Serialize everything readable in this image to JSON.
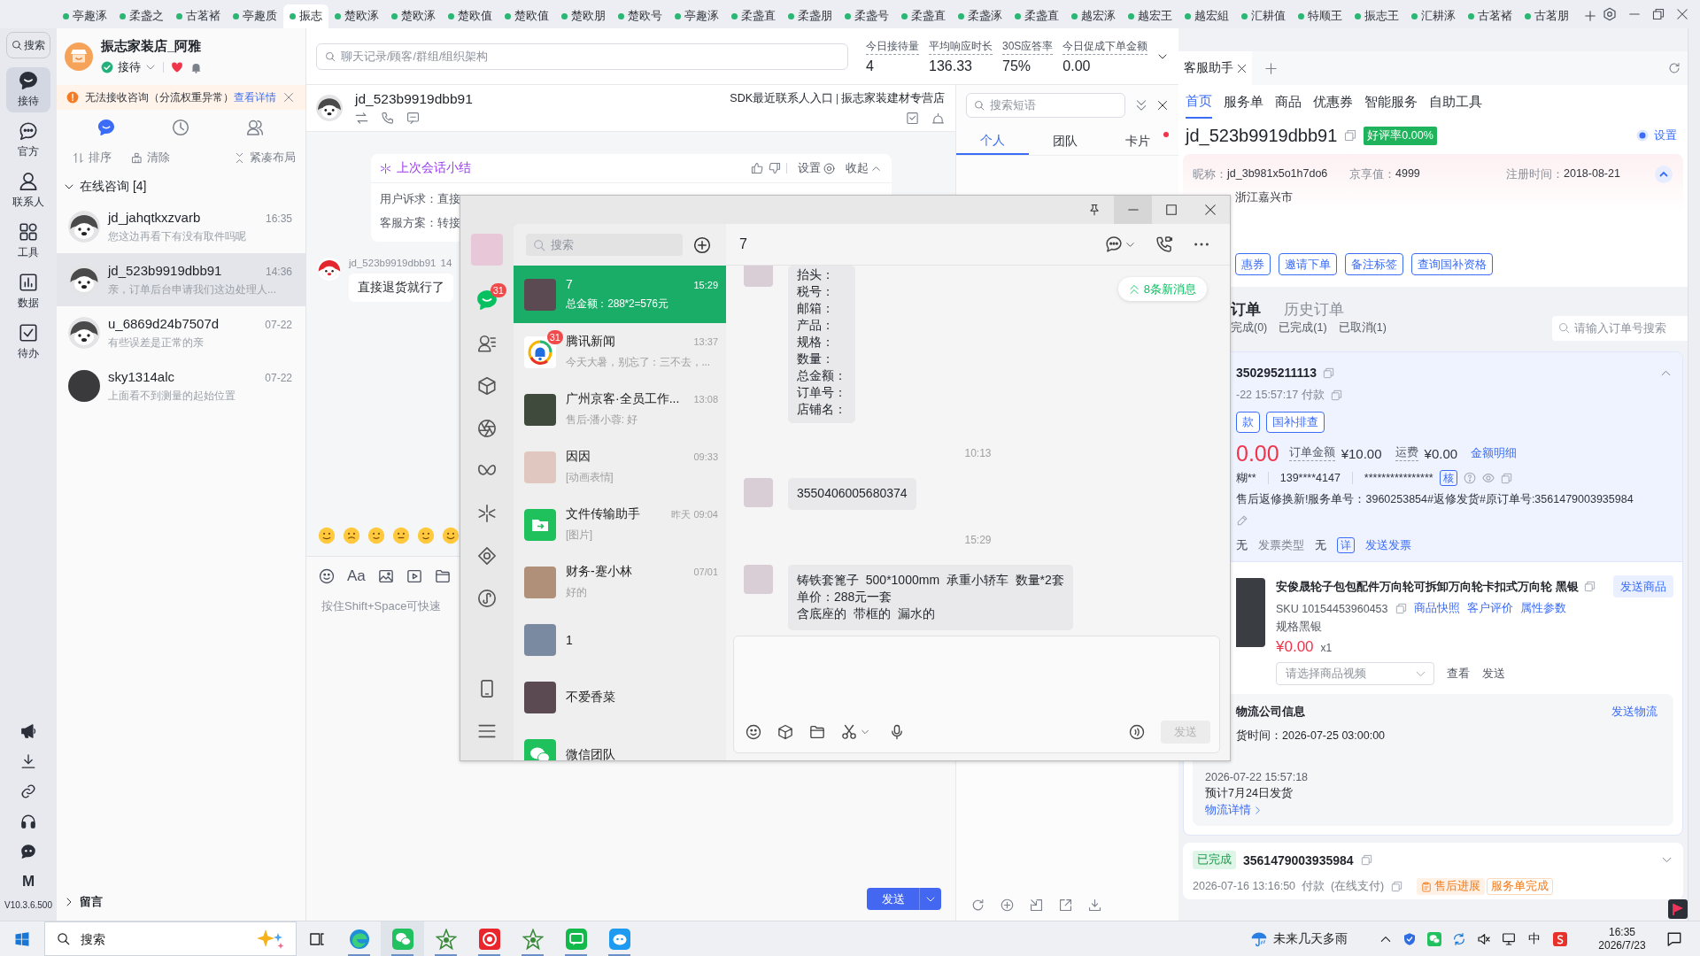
{
  "tab_bar": {
    "tabs": [
      {
        "label": "亭趣涿",
        "selected": false
      },
      {
        "label": "柔盏之",
        "selected": false
      },
      {
        "label": "古茗褚",
        "selected": false
      },
      {
        "label": "亭趣质",
        "selected": false
      },
      {
        "label": "振志",
        "selected": true
      },
      {
        "label": "楚欧涿",
        "selected": false
      },
      {
        "label": "楚欧涿",
        "selected": false
      },
      {
        "label": "楚欧值",
        "selected": false
      },
      {
        "label": "楚欧值",
        "selected": false
      },
      {
        "label": "楚欧朋",
        "selected": false
      },
      {
        "label": "楚欧号",
        "selected": false
      },
      {
        "label": "亭趣涿",
        "selected": false
      },
      {
        "label": "柔盏直",
        "selected": false
      },
      {
        "label": "柔盏朋",
        "selected": false
      },
      {
        "label": "柔盏号",
        "selected": false
      },
      {
        "label": "柔盏直",
        "selected": false
      },
      {
        "label": "柔盏涿",
        "selected": false
      },
      {
        "label": "柔盏直",
        "selected": false
      },
      {
        "label": "越宏涿",
        "selected": false
      },
      {
        "label": "越宏王",
        "selected": false
      },
      {
        "label": "越宏組",
        "selected": false
      },
      {
        "label": "汇耕值",
        "selected": false
      },
      {
        "label": "特顺王",
        "selected": false
      },
      {
        "label": "振志王",
        "selected": false
      },
      {
        "label": "汇耕涿",
        "selected": false
      },
      {
        "label": "古茗褚",
        "selected": false
      },
      {
        "label": "古茗朋",
        "selected": false
      }
    ]
  },
  "nav": {
    "search": "搜索",
    "items": [
      {
        "label": "接待",
        "selected": true
      },
      {
        "label": "官方",
        "selected": false
      },
      {
        "label": "联系人",
        "selected": false
      },
      {
        "label": "工具",
        "selected": false
      },
      {
        "label": "数据",
        "selected": false
      },
      {
        "label": "待办",
        "selected": false
      }
    ],
    "logo": "M",
    "version": "V10.3.6.500"
  },
  "shop": {
    "name": "振志家装店_阿雅",
    "status": "接待",
    "online": true
  },
  "alert": {
    "text": "无法接收咨询（分流权重异常）",
    "link": "查看详情"
  },
  "list_tabs": [
    {
      "kind": "chat",
      "selected": true
    },
    {
      "kind": "history",
      "selected": false
    },
    {
      "kind": "contacts",
      "selected": false
    }
  ],
  "list_actions": [
    {
      "kind": "sort",
      "label": "排序"
    },
    {
      "kind": "clear",
      "label": "清除"
    },
    {
      "kind": "compact",
      "label": "紧凑布局"
    }
  ],
  "group": {
    "title": "在线咨询 [4]",
    "expanded": true
  },
  "conversations": [
    {
      "kind": "mascot",
      "name": "jd_jahqtkxzvarb",
      "time": "16:35",
      "preview": "您这边再看下有没有取件吗呢",
      "selected": false
    },
    {
      "kind": "mascot",
      "name": "jd_523b9919dbb91",
      "time": "14:36",
      "preview": "亲，订单后台申请我们这边处理人...",
      "selected": true
    },
    {
      "kind": "mascot",
      "name": "u_6869d24b7507d",
      "time": "07-22",
      "preview": "有些误差是正常的亲",
      "selected": false
    },
    {
      "kind": "photo",
      "name": "sky1314alc",
      "time": "07-22",
      "preview": "上面看不到测量的起始位置",
      "selected": false
    }
  ],
  "collapsed_group": {
    "title": "留言",
    "expanded": false
  },
  "workspace": {
    "search_placeholder": "聊天记录/顾客/群组/组织架构",
    "metrics": [
      {
        "label": "今日接待量",
        "value": "4"
      },
      {
        "label": "平均响应时长",
        "value": "136.33"
      },
      {
        "label": "30S应答率",
        "value": "75%"
      },
      {
        "label": "今日促成下单金额",
        "value": "0.00"
      }
    ]
  },
  "chat": {
    "name": "jd_523b9919dbb91",
    "header_links": [
      "SDK最近联系人入口",
      "振志家装建材专营店"
    ],
    "summary": {
      "title": "上次会话小结",
      "settings": "设置",
      "collapse": "收起",
      "rows": [
        "用户诉求：直接",
        "客服方案：转接"
      ]
    },
    "messages": [
      {
        "sender": "jd_523b9919dbb91",
        "time": "14",
        "text": "直接退货就行了"
      }
    ],
    "format_label": "Aa",
    "input_placeholder": "按住Shift+Space可快速",
    "send": "发送"
  },
  "quick_replies": {
    "search_placeholder": "搜索短语",
    "tabs": [
      {
        "label": "个人",
        "selected": true,
        "unread": false
      },
      {
        "label": "团队",
        "selected": false,
        "unread": false
      },
      {
        "label": "卡片",
        "selected": false,
        "unread": true
      }
    ]
  },
  "assistant": {
    "tab": "客服助手",
    "nav": [
      {
        "label": "首页",
        "selected": true
      },
      {
        "label": "服务单",
        "selected": false
      },
      {
        "label": "商品",
        "selected": false
      },
      {
        "label": "优惠券",
        "selected": false
      },
      {
        "label": "智能服务",
        "selected": false
      },
      {
        "label": "自助工具",
        "selected": false
      }
    ],
    "customer": {
      "name": "jd_523b9919dbb91",
      "rating": "好评率0.00%",
      "settings": "设置"
    },
    "profile": [
      {
        "label": "昵称：",
        "value": "jd_3b981x5o1h7do6"
      },
      {
        "label": "京享值：",
        "value": "4999"
      },
      {
        "label": "注册时间：",
        "value": "2018-08-21"
      }
    ],
    "region": "浙江嘉兴市",
    "actions": [
      "惠券",
      "邀请下单",
      "备注标签",
      "查询国补资格"
    ],
    "order_tabs": [
      {
        "label": "订单",
        "selected": true
      },
      {
        "label": "历史订单",
        "selected": false
      }
    ],
    "order_filters": [
      "完成(0)",
      "已完成(1)",
      "已取消(1)"
    ],
    "order_search_placeholder": "请输入订单号搜索",
    "order": {
      "id": "350295211113",
      "paid": "-22 15:57:17 付款",
      "buttons": [
        "款",
        "国补排查"
      ],
      "total": "0.00",
      "amounts": [
        {
          "label": "订单金额",
          "value": "¥10.00"
        },
        {
          "label": "运费",
          "value": "¥0.00"
        }
      ],
      "amount_link": "金额明细",
      "buyer": "糊**",
      "phone": "139****4147",
      "address": "****************",
      "verify": "核",
      "note": "售后返修换新!服务单号：3960253854#返修发货#原订单号:3561479003935984",
      "invoice": {
        "value": "无",
        "type_label": "发票类型",
        "type": "无",
        "detail": "详",
        "send": "发送发票"
      }
    },
    "product": {
      "title": "安俊晟轮子包包配件万向轮可拆卸万向轮卡扣式万向轮 黑银",
      "send": "发送商品",
      "sku": "SKU 10154453960453",
      "links": [
        "商品快照",
        "客户评价",
        "属性参数"
      ],
      "spec": "规格黑银",
      "price": "¥0.00",
      "qty": "x1",
      "video_placeholder": "请选择商品视频",
      "view": "查看",
      "send_video": "发送"
    },
    "logistics": {
      "title": "物流公司信息",
      "send": "发送物流",
      "ship_time": "货时间：2026-07-25 03:00:00",
      "time": "2026-07-22 15:57:18",
      "eta": "预计7月24日发货",
      "detail": "物流详情"
    },
    "history_order": {
      "status": "已完成",
      "id": "3561479003935984",
      "paid": "2026-07-16 13:16:50  付款  (在线支付)",
      "progress": "售后进展",
      "service": "服务单完成"
    }
  },
  "wechat": {
    "unread_badge": "31",
    "search_placeholder": "搜索",
    "chats": [
      {
        "kind": "photo",
        "name": "7",
        "time": "15:29",
        "preview": "总金额：288*2=576元",
        "selected": true
      },
      {
        "kind": "news",
        "name": "腾讯新闻",
        "time": "13:37",
        "preview": "今天大暑，别忘了：三不去，...",
        "badge": "31",
        "selected": false
      },
      {
        "kind": "photo",
        "name": "广州京客·全员工作...",
        "time": "13:08",
        "preview": "售后-潘小蓉: 好",
        "selected": false
      },
      {
        "kind": "photo",
        "name": "因因",
        "time": "09:33",
        "preview": "[动画表情]",
        "selected": false
      },
      {
        "kind": "file",
        "name": "文件传输助手",
        "time": "昨天 09:04",
        "preview": "[图片]",
        "selected": false
      },
      {
        "kind": "photo",
        "name": "财务-蹇小林",
        "time": "07/01",
        "preview": "好的",
        "selected": false
      },
      {
        "kind": "photo",
        "name": "1",
        "selected": false
      },
      {
        "kind": "photo",
        "name": "不爱香菜",
        "selected": false
      },
      {
        "kind": "team",
        "name": "微信团队",
        "selected": false
      }
    ],
    "conversation": {
      "title": "7",
      "new_messages": "8条新消息",
      "messages": [
        {
          "kind": "bubble",
          "lines": [
            "抬头：",
            "税号：",
            "邮箱：",
            "产品：",
            "规格：",
            "数量：",
            "总金额：",
            "订单号：",
            "店铺名："
          ]
        },
        {
          "kind": "time",
          "text": "10:13"
        },
        {
          "kind": "bubble",
          "lines": [
            "3550406005680374"
          ]
        },
        {
          "kind": "time",
          "text": "15:29"
        },
        {
          "kind": "bubble",
          "lines": [
            "铸铁套篦子  500*1000mm  承重小轿车  数量*2套",
            "单价：288元一套",
            "含底座的  带框的  漏水的"
          ]
        }
      ],
      "send": {
        "label": "发送",
        "disabled": true
      }
    }
  },
  "taskbar": {
    "search_placeholder": "搜索",
    "apps": [
      {
        "kind": "browser",
        "selected": false
      },
      {
        "kind": "wechat",
        "selected": true
      },
      {
        "kind": "star",
        "selected": false
      },
      {
        "kind": "record",
        "selected": false
      },
      {
        "kind": "star",
        "selected": false
      },
      {
        "kind": "chat",
        "selected": false
      },
      {
        "kind": "bot",
        "selected": false
      }
    ],
    "weather": "未来几天多雨",
    "ime": "中",
    "time": "16:35",
    "date": "2026/7/23"
  }
}
